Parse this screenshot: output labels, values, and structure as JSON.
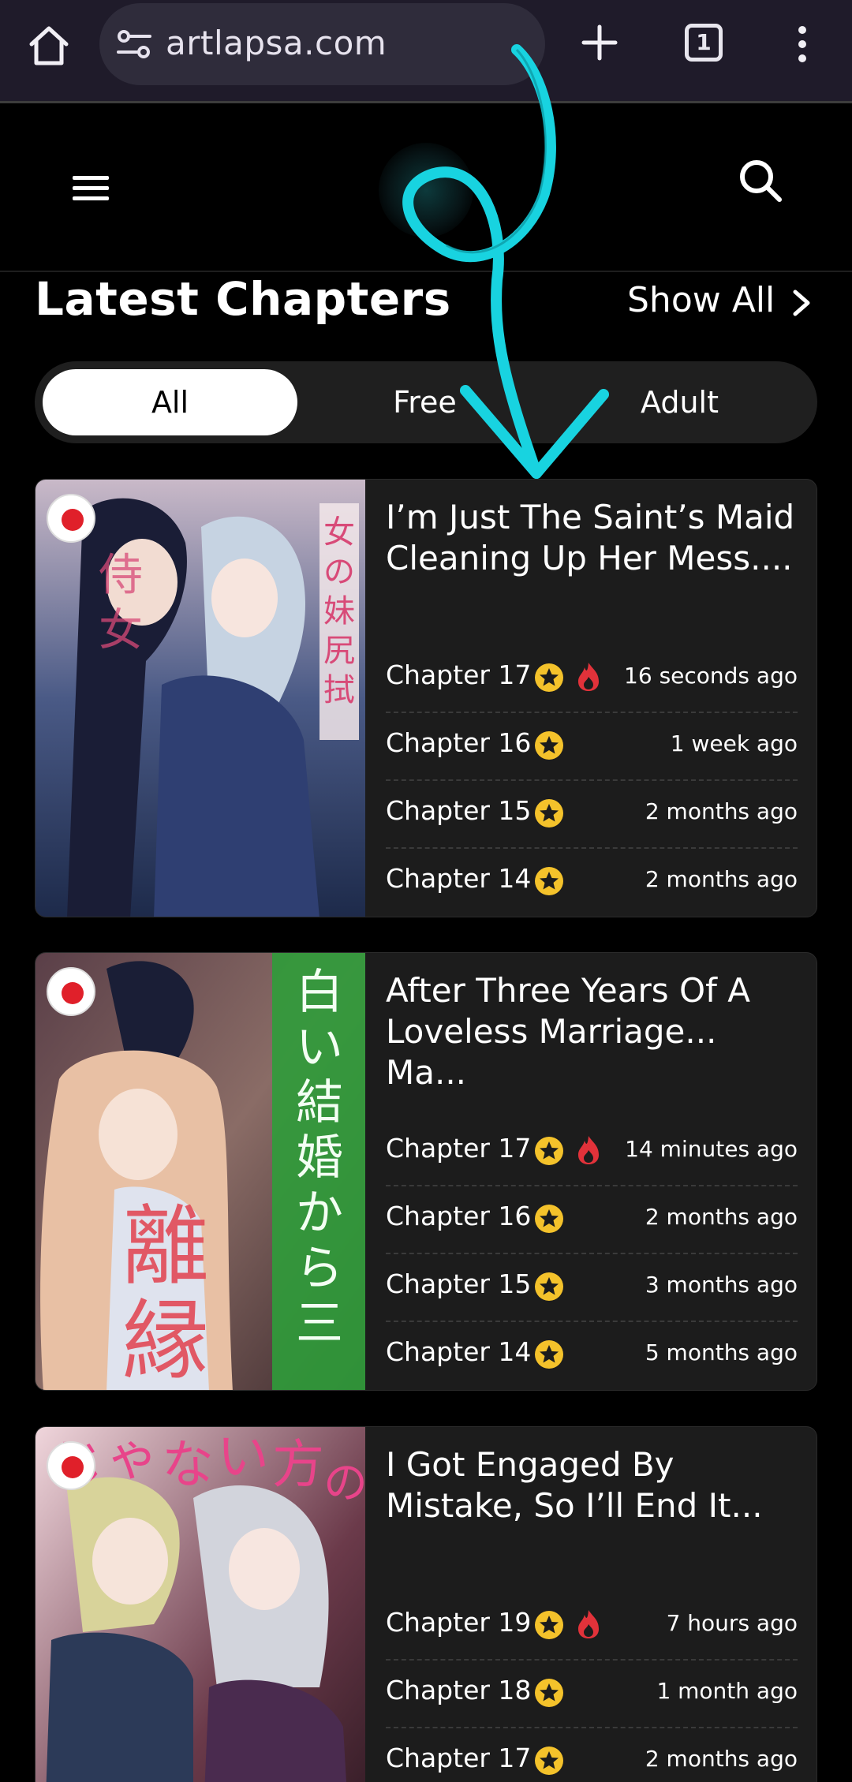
{
  "browser": {
    "url": "artlapsa.com",
    "tab_count": "1"
  },
  "section": {
    "title": "Latest Chapters",
    "show_all": "Show All"
  },
  "filter": {
    "options": [
      "All",
      "Free",
      "Adult"
    ],
    "selected": "All"
  },
  "colors": {
    "accent_star": "#f4c22b",
    "fire": "#e2323a",
    "arrow": "#18d3e0"
  },
  "series": [
    {
      "title": "I’m Just The Saint’s Maid Cleaning Up Her Mess....",
      "cover_flag": "jp",
      "chapters": [
        {
          "label": "Chapter 17",
          "premium": true,
          "hot": true,
          "ago": "16 seconds ago"
        },
        {
          "label": "Chapter 16",
          "premium": true,
          "hot": false,
          "ago": "1 week ago"
        },
        {
          "label": "Chapter 15",
          "premium": true,
          "hot": false,
          "ago": "2 months ago"
        },
        {
          "label": "Chapter 14",
          "premium": true,
          "hot": false,
          "ago": "2 months ago"
        }
      ]
    },
    {
      "title": "After Three Years Of A Loveless Marriage... Ma...",
      "cover_flag": "jp",
      "chapters": [
        {
          "label": "Chapter 17",
          "premium": true,
          "hot": true,
          "ago": "14 minutes ago"
        },
        {
          "label": "Chapter 16",
          "premium": true,
          "hot": false,
          "ago": "2 months ago"
        },
        {
          "label": "Chapter 15",
          "premium": true,
          "hot": false,
          "ago": "3 months ago"
        },
        {
          "label": "Chapter 14",
          "premium": true,
          "hot": false,
          "ago": "5 months ago"
        }
      ]
    },
    {
      "title": "I Got Engaged By Mistake, So I’ll End It...",
      "cover_flag": "jp",
      "chapters": [
        {
          "label": "Chapter 19",
          "premium": true,
          "hot": true,
          "ago": "7 hours ago"
        },
        {
          "label": "Chapter 18",
          "premium": true,
          "hot": false,
          "ago": "1 month ago"
        },
        {
          "label": "Chapter 17",
          "premium": true,
          "hot": false,
          "ago": "2 months ago"
        }
      ]
    }
  ]
}
